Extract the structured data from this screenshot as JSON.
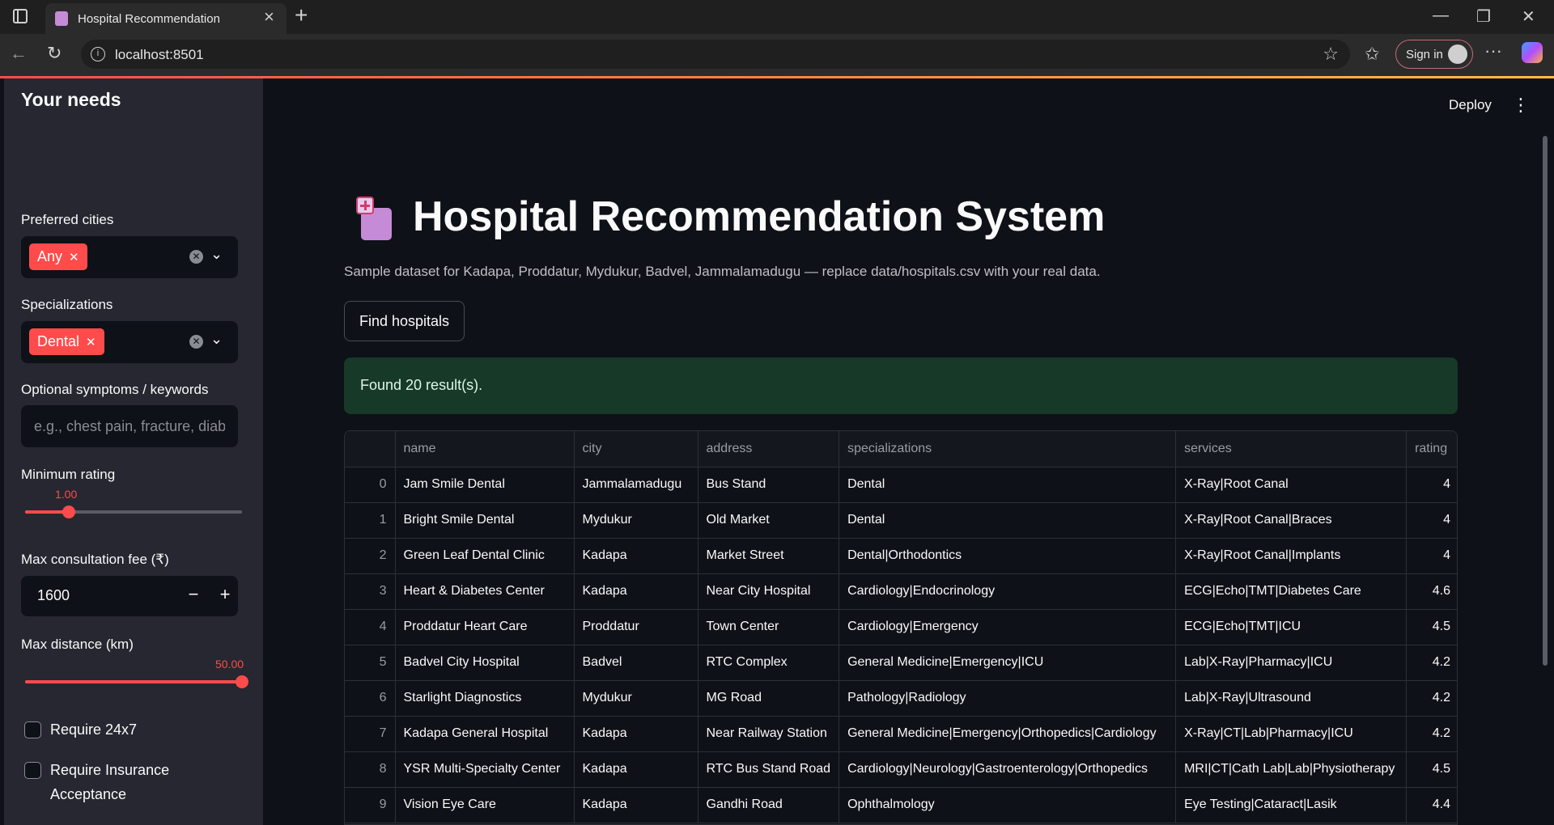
{
  "browser": {
    "tab_title": "Hospital Recommendation",
    "url": "localhost:8501",
    "sign_in": "Sign in"
  },
  "app": {
    "deploy": "Deploy",
    "title": "Hospital Recommendation System",
    "caption": "Sample dataset for Kadapa, Proddatur, Mydukur, Badvel, Jammalamadugu — replace data/hospitals.csv with your real data.",
    "find_button": "Find hospitals",
    "result_message": "Found 20 result(s)."
  },
  "sidebar": {
    "heading": "Your needs",
    "cities_label": "Preferred cities",
    "cities_chip": "Any",
    "spec_label": "Specializations",
    "spec_chip": "Dental",
    "symptoms_label": "Optional symptoms / keywords",
    "symptoms_placeholder": "e.g., chest pain, fracture, diabetes",
    "rating_label": "Minimum rating",
    "rating_value": "1.00",
    "rating_fraction": 0.2,
    "fee_label": "Max consultation fee (₹)",
    "fee_value": "1600",
    "distance_label": "Max distance (km)",
    "distance_value": "50.00",
    "distance_fraction": 1.0,
    "require_24x7": "Require 24x7",
    "require_insurance": "Require Insurance Acceptance"
  },
  "table": {
    "columns": [
      "",
      "name",
      "city",
      "address",
      "specializations",
      "services",
      "rating"
    ],
    "rows": [
      [
        "0",
        "Jam Smile Dental",
        "Jammalamadugu",
        "Bus Stand",
        "Dental",
        "X-Ray|Root Canal",
        "4"
      ],
      [
        "1",
        "Bright Smile Dental",
        "Mydukur",
        "Old Market",
        "Dental",
        "X-Ray|Root Canal|Braces",
        "4"
      ],
      [
        "2",
        "Green Leaf Dental Clinic",
        "Kadapa",
        "Market Street",
        "Dental|Orthodontics",
        "X-Ray|Root Canal|Implants",
        "4"
      ],
      [
        "3",
        "Heart & Diabetes Center",
        "Kadapa",
        "Near City Hospital",
        "Cardiology|Endocrinology",
        "ECG|Echo|TMT|Diabetes Care",
        "4.6"
      ],
      [
        "4",
        "Proddatur Heart Care",
        "Proddatur",
        "Town Center",
        "Cardiology|Emergency",
        "ECG|Echo|TMT|ICU",
        "4.5"
      ],
      [
        "5",
        "Badvel City Hospital",
        "Badvel",
        "RTC Complex",
        "General Medicine|Emergency|ICU",
        "Lab|X-Ray|Pharmacy|ICU",
        "4.2"
      ],
      [
        "6",
        "Starlight Diagnostics",
        "Mydukur",
        "MG Road",
        "Pathology|Radiology",
        "Lab|X-Ray|Ultrasound",
        "4.2"
      ],
      [
        "7",
        "Kadapa General Hospital",
        "Kadapa",
        "Near Railway Station",
        "General Medicine|Emergency|Orthopedics|Cardiology",
        "X-Ray|CT|Lab|Pharmacy|ICU",
        "4.2"
      ],
      [
        "8",
        "YSR Multi-Specialty Center",
        "Kadapa",
        "RTC Bus Stand Road",
        "Cardiology|Neurology|Gastroenterology|Orthopedics",
        "MRI|CT|Cath Lab|Lab|Physiotherapy",
        "4.5"
      ],
      [
        "9",
        "Vision Eye Care",
        "Kadapa",
        "Gandhi Road",
        "Ophthalmology",
        "Eye Testing|Cataract|Lasik",
        "4.4"
      ]
    ]
  }
}
